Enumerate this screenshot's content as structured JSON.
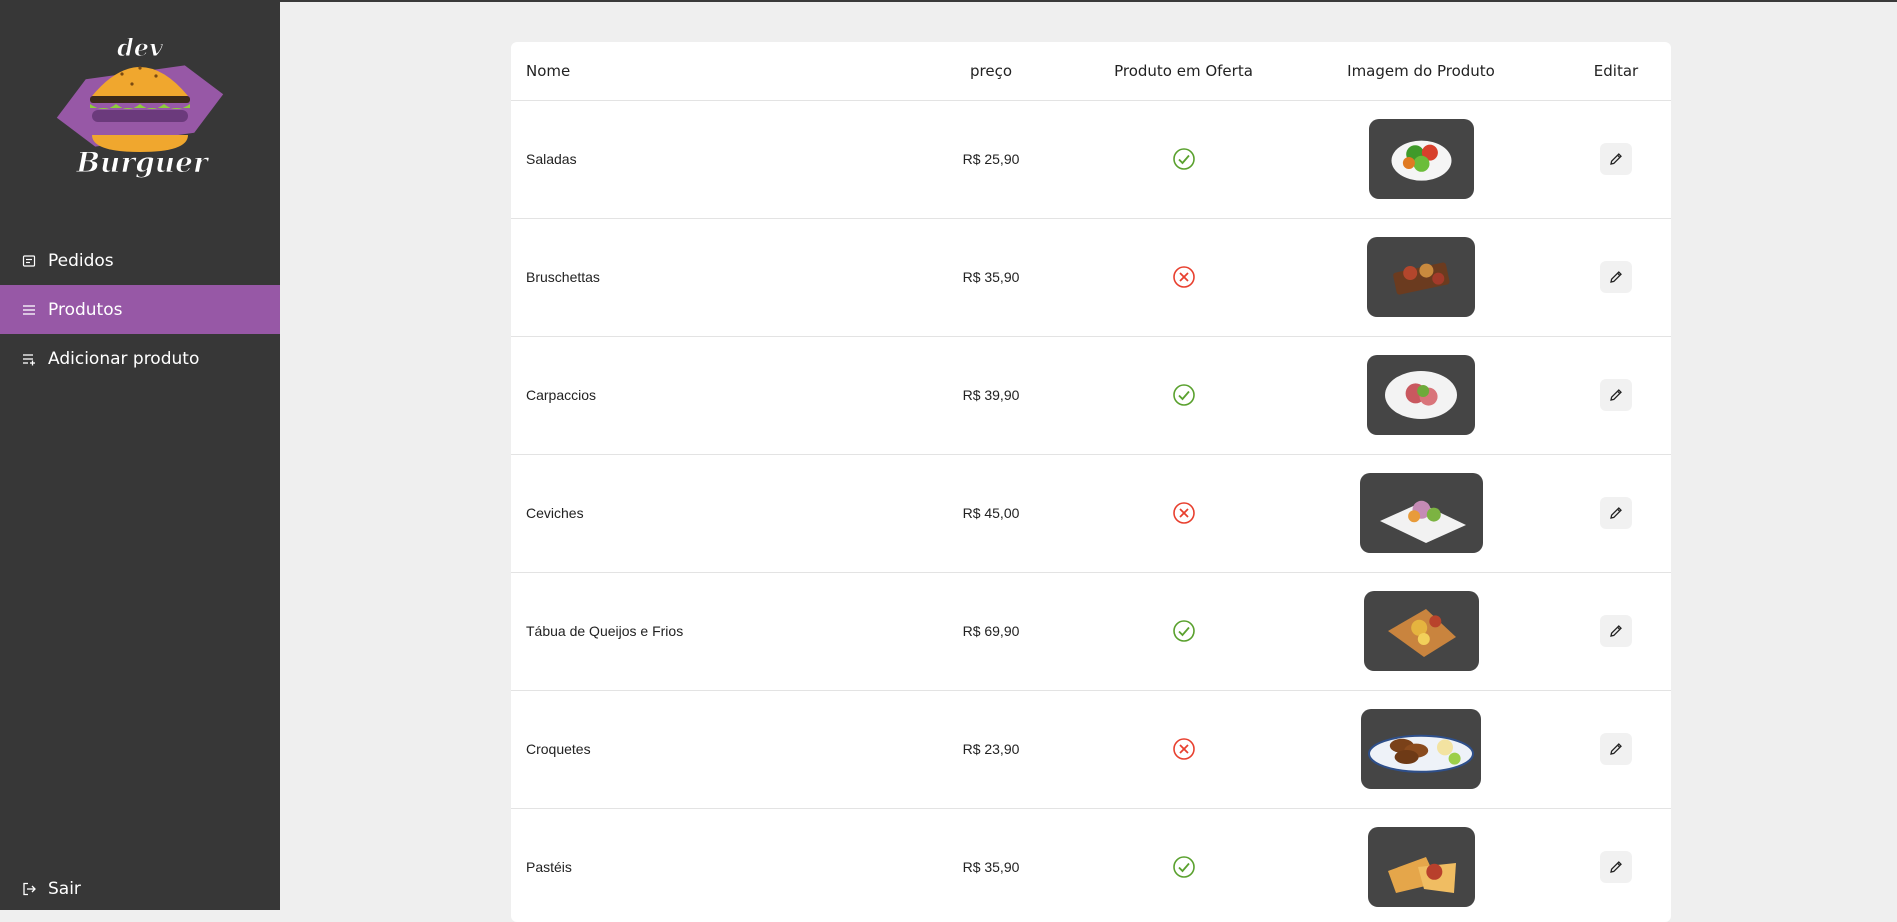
{
  "brand": {
    "logo_top": "dev",
    "logo_bottom": "Burguer"
  },
  "sidebar": {
    "items": [
      {
        "label": "Pedidos",
        "icon": "receipt-icon",
        "active": false
      },
      {
        "label": "Produtos",
        "icon": "list-icon",
        "active": true
      },
      {
        "label": "Adicionar produto",
        "icon": "playlist-add-icon",
        "active": false
      }
    ],
    "logout_label": "Sair"
  },
  "table": {
    "headers": {
      "name": "Nome",
      "price": "preço",
      "offer": "Produto em Oferta",
      "image": "Imagem do Produto",
      "edit": "Editar"
    },
    "rows": [
      {
        "name": "Saladas",
        "price": "R$ 25,90",
        "offer": true,
        "image": "salad"
      },
      {
        "name": "Bruschettas",
        "price": "R$ 35,90",
        "offer": false,
        "image": "bruschetta"
      },
      {
        "name": "Carpaccios",
        "price": "R$ 39,90",
        "offer": true,
        "image": "carpaccio"
      },
      {
        "name": "Ceviches",
        "price": "R$ 45,00",
        "offer": false,
        "image": "ceviche"
      },
      {
        "name": "Tábua de Queijos e Frios",
        "price": "R$ 69,90",
        "offer": true,
        "image": "cheese-board"
      },
      {
        "name": "Croquetes",
        "price": "R$ 23,90",
        "offer": false,
        "image": "croquettes"
      },
      {
        "name": "Pastéis",
        "price": "R$ 35,90",
        "offer": true,
        "image": "pastries"
      }
    ]
  },
  "colors": {
    "sidebar_bg": "#373737",
    "active_item": "#9758a6",
    "offer_yes": "#5aa12e",
    "offer_no": "#e8402f",
    "page_bg": "#efefef"
  }
}
